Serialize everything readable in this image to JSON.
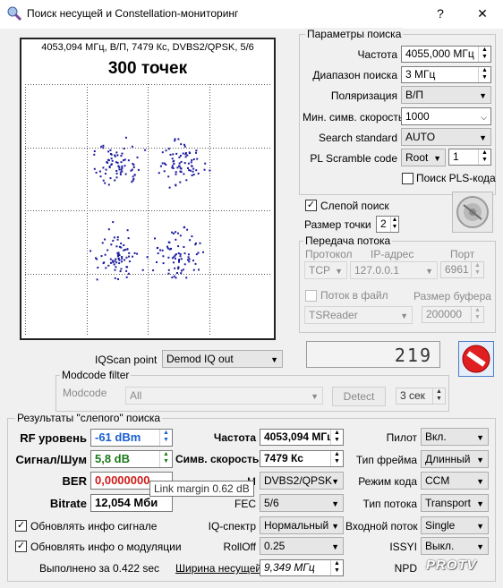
{
  "window": {
    "title": "Поиск несущей и Constellation-мониторинг",
    "help": "?",
    "close": "✕"
  },
  "constellation": {
    "header": "4053,094 МГц, В/П, 7479 Кс, DVBS2/QPSK, 5/6",
    "points_label": "300 точек",
    "points_count": 300
  },
  "search_params": {
    "group_title": "Параметры поиска",
    "frequency_label": "Частота",
    "frequency_value": "4055,000 МГц",
    "range_label": "Диапазон поиска",
    "range_value": "3 МГц",
    "polarization_label": "Поляризация",
    "polarization_value": "В/П",
    "min_sr_label": "Мин. симв. скорость",
    "min_sr_value": "1000",
    "standard_label": "Search standard",
    "standard_value": "AUTO",
    "pls_label": "PL Scramble code",
    "pls_mode": "Root",
    "pls_value": "1",
    "pls_search_label": "Поиск PLS-кода"
  },
  "blind": {
    "label": "Слепой поиск",
    "checked": true,
    "point_size_label": "Размер точки",
    "point_size_value": "2"
  },
  "stream": {
    "group_title": "Передача потока",
    "protocol_label": "Протокол",
    "ip_label": "IP-адрес",
    "port_label": "Порт",
    "protocol_value": "TCP",
    "ip_value": "127.0.0.1",
    "port_value": "6961",
    "to_file_label": "Поток в файл",
    "buffer_label": "Размер буфера",
    "reader_value": "TSReader",
    "buffer_value": "200000"
  },
  "counter": "219",
  "iqscan": {
    "label": "IQScan point",
    "value": "Demod IQ out"
  },
  "modcode": {
    "group_title": "Modcode filter",
    "label": "Modcode",
    "value": "All",
    "detect": "Detect",
    "time": "3 сек"
  },
  "results": {
    "group_title": "Результаты \"слепого\" поиска",
    "rf_label": "RF уровень",
    "rf_value": "-61 dBm",
    "snr_label": "Сигнал/Шум",
    "snr_value": "5,8 dB",
    "ber_label": "BER",
    "ber_value": "0,0000000",
    "bitrate_label": "Bitrate",
    "bitrate_value": "12,054 Мби",
    "tooltip": "Link margin 0.62 dB",
    "freq_label": "Частота",
    "freq_value": "4053,094 МГц",
    "sr_label": "Симв. скорость",
    "sr_value": "7479 Кс",
    "mod_label_partial": "М",
    "mod_value": "DVBS2/QPSK",
    "fec_label": "FEC",
    "fec_value": "5/6",
    "iq_label": "IQ-спектр",
    "iq_value": "Нормальный",
    "rolloff_label": "RollOff",
    "rolloff_value": "0.25",
    "bw_label": "Ширина несущей",
    "bw_value": "9,349 МГц",
    "pilot_label": "Пилот",
    "pilot_value": "Вкл.",
    "frame_label": "Тип фрейма",
    "frame_value": "Длинный",
    "code_label": "Режим кода",
    "code_value": "CCM",
    "stream_type_label": "Тип потока",
    "stream_type_value": "Transport",
    "input_label": "Входной поток",
    "input_value": "Single",
    "issyi_label": "ISSYI",
    "issyi_value": "Выкл.",
    "npd_label": "NPD",
    "upd_signal_label": "Обновлять инфо сигнале",
    "upd_mod_label": "Обновлять инфо о модуляции",
    "done_label": "Выполнено за 0.422 sec"
  },
  "watermark": "PROTV",
  "colors": {
    "dot": "#1a1aa0",
    "snr": "#1a7a1a",
    "rf": "#1a5fd0",
    "ber": "#d01a1a"
  }
}
